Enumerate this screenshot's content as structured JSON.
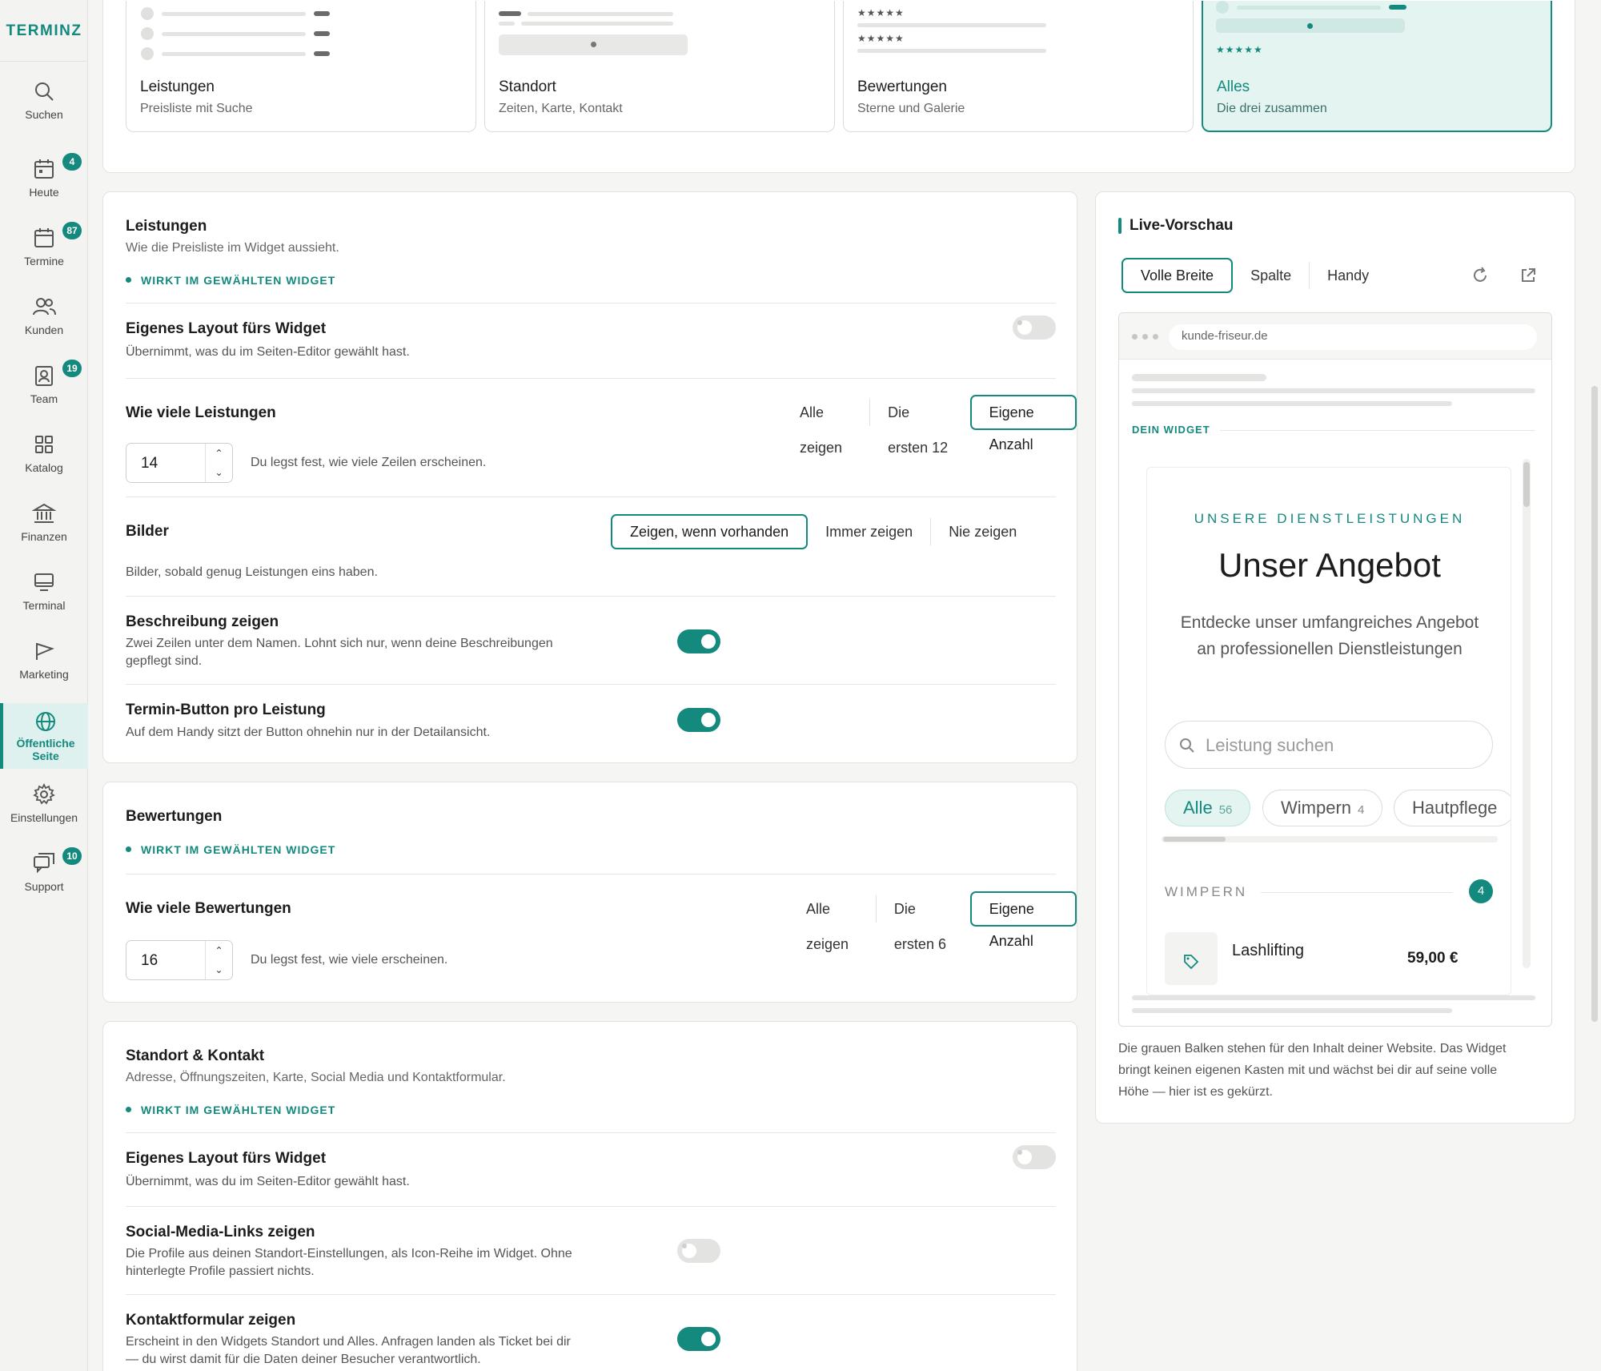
{
  "brand": "TERMINZ",
  "colors": {
    "accent": "#14897d",
    "accent_light": "#e3f4f1",
    "text": "#1c1c1c",
    "muted": "#666666"
  },
  "sidebar": {
    "items": [
      {
        "label": "Suchen",
        "icon": "search-icon",
        "badge": ""
      },
      {
        "label": "Heute",
        "icon": "calendar-icon",
        "badge": "4"
      },
      {
        "label": "Termine",
        "icon": "calendar-icon",
        "badge": "87"
      },
      {
        "label": "Kunden",
        "icon": "users-icon",
        "badge": ""
      },
      {
        "label": "Team",
        "icon": "id-card-icon",
        "badge": "19"
      },
      {
        "label": "Katalog",
        "icon": "grid-icon",
        "badge": ""
      },
      {
        "label": "Finanzen",
        "icon": "bank-icon",
        "badge": ""
      },
      {
        "label": "Terminal",
        "icon": "monitor-icon",
        "badge": ""
      },
      {
        "label": "Marketing",
        "icon": "megaphone-icon",
        "badge": ""
      },
      {
        "label": "Öffentliche",
        "label2": "Seite",
        "icon": "globe-icon",
        "badge": "",
        "active": true
      },
      {
        "label": "Einstellungen",
        "icon": "gear-icon",
        "badge": ""
      },
      {
        "label": "Support",
        "icon": "chat-icon",
        "badge": "10"
      }
    ]
  },
  "widget_cards": [
    {
      "title": "Leistungen",
      "subtitle": "Preisliste mit Suche",
      "selected": false
    },
    {
      "title": "Standort",
      "subtitle": "Zeiten, Karte, Kontakt",
      "selected": false
    },
    {
      "title": "Bewertungen",
      "subtitle": "Sterne und Galerie",
      "selected": false
    },
    {
      "title": "Alles",
      "subtitle": "Die drei zusammen",
      "selected": true
    }
  ],
  "leistungen": {
    "title": "Leistungen",
    "subtitle": "Wie die Preisliste im Widget aussieht.",
    "tag": "WIRKT IM GEWÄHLTEN WIDGET",
    "own_layout": {
      "title": "Eigenes Layout fürs Widget",
      "desc": "Übernimmt, was du im Seiten-Editor gewählt hast.",
      "on": false
    },
    "count": {
      "title": "Wie viele Leistungen",
      "options": [
        "Alle zeigen",
        "Die ersten 12",
        "Eigene Anzahl"
      ],
      "selected": "Eigene Anzahl",
      "value": "14",
      "hint": "Du legst fest, wie viele Zeilen erscheinen."
    },
    "images": {
      "title": "Bilder",
      "options": [
        "Zeigen, wenn vorhanden",
        "Immer zeigen",
        "Nie zeigen"
      ],
      "selected": "Zeigen, wenn vorhanden",
      "hint": "Bilder, sobald genug Leistungen eins haben."
    },
    "description": {
      "title": "Beschreibung zeigen",
      "desc1": "Zwei Zeilen unter dem Namen. Lohnt sich nur, wenn deine Beschreibungen",
      "desc2": "gepflegt sind.",
      "on": true
    },
    "booking_button": {
      "title": "Termin-Button pro Leistung",
      "desc": "Auf dem Handy sitzt der Button ohnehin nur in der Detailansicht.",
      "on": true
    }
  },
  "bewertungen": {
    "title": "Bewertungen",
    "tag": "WIRKT IM GEWÄHLTEN WIDGET",
    "count": {
      "title": "Wie viele Bewertungen",
      "options": [
        "Alle zeigen",
        "Die ersten 6",
        "Eigene Anzahl"
      ],
      "selected": "Eigene Anzahl",
      "value": "16",
      "hint": "Du legst fest, wie viele erscheinen."
    }
  },
  "standort": {
    "title": "Standort & Kontakt",
    "subtitle": "Adresse, Öffnungszeiten, Karte, Social Media und Kontaktformular.",
    "tag": "WIRKT IM GEWÄHLTEN WIDGET",
    "own_layout": {
      "title": "Eigenes Layout fürs Widget",
      "desc": "Übernimmt, was du im Seiten-Editor gewählt hast.",
      "on": false
    },
    "social": {
      "title": "Social-Media-Links zeigen",
      "desc1": "Die Profile aus deinen Standort-Einstellungen, als Icon-Reihe im Widget. Ohne",
      "desc2": "hinterlegte Profile passiert nichts.",
      "on": false
    },
    "contact_form": {
      "title": "Kontaktformular zeigen",
      "desc1": "Erscheint in den Widgets Standort und Alles. Anfragen landen als Ticket bei dir",
      "desc2": "— du wirst damit für die Daten deiner Besucher verantwortlich.",
      "on": true
    }
  },
  "preview": {
    "title": "Live-Vorschau",
    "tabs": [
      "Volle Breite",
      "Spalte",
      "Handy"
    ],
    "selected_tab": "Volle Breite",
    "url": "kunde-friseur.de",
    "widget_label": "DEIN WIDGET",
    "eyebrow": "UNSERE DIENSTLEISTUNGEN",
    "heading": "Unser Angebot",
    "lead1": "Entdecke unser umfangreiches Angebot",
    "lead2": "an professionellen Dienstleistungen",
    "search_placeholder": "Leistung suchen",
    "chips": [
      {
        "label": "Alle",
        "count": "56",
        "selected": true
      },
      {
        "label": "Wimpern",
        "count": "4",
        "selected": false
      },
      {
        "label": "Hautpflege",
        "count": "",
        "selected": false
      }
    ],
    "category": {
      "label": "WIMPERN",
      "count": "4"
    },
    "service": {
      "name": "Lashlifting",
      "price": "59,00 €"
    },
    "note1": "Die grauen Balken stehen für den Inhalt deiner Website. Das Widget",
    "note2": "bringt keinen eigenen Kasten mit und wächst bei dir auf seine volle",
    "note3": "Höhe — hier ist es gekürzt."
  }
}
